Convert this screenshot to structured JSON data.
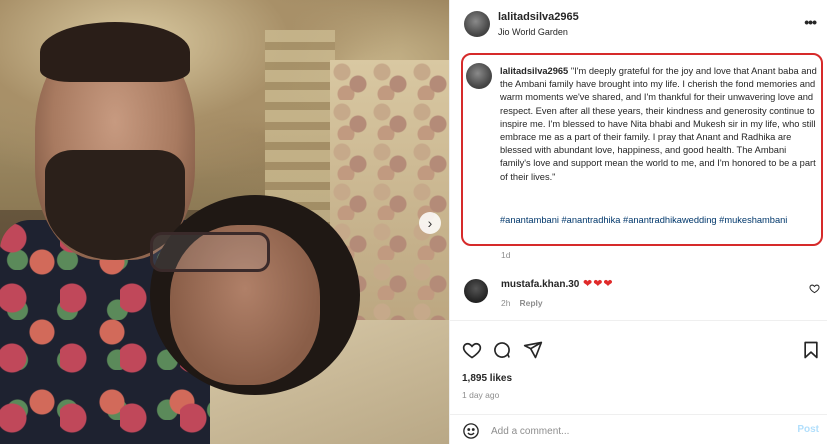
{
  "post": {
    "username": "lalitadsilva2965",
    "location": "Jio World Garden",
    "more_icon": "more-horizontal-icon"
  },
  "caption": {
    "username": "lalitadsilva2965",
    "text": "\"I'm deeply grateful for the joy and love that Anant baba and the Ambani family have brought into my life. I cherish the fond memories and warm moments we've shared, and I'm thankful for their unwavering love and respect. Even after all these years, their kindness and generosity continue to inspire me. I'm blessed to have Nita bhabi and Mukesh sir in my life, who still embrace me as a part of their family. I pray that Anant and Radhika are blessed with abundant love, happiness, and good health. The Ambani family's love and support mean the world to me, and I'm honored to be a part of their lives.\"",
    "hashtags": "#anantambani #anantradhika #anantradhikawedding #mukeshambani",
    "time": "1d",
    "highlight_color": "#d62a2a"
  },
  "comments": [
    {
      "username": "mustafa.khan.30",
      "text": "❤❤❤",
      "time": "2h",
      "reply_label": "Reply"
    }
  ],
  "actions": {
    "likes": "1,895 likes",
    "posted": "1 day ago",
    "icons": [
      "heart-icon",
      "comment-icon",
      "share-icon",
      "bookmark-icon"
    ]
  },
  "add_comment": {
    "placeholder": "Add a comment...",
    "post_label": "Post"
  },
  "photo": {
    "next_icon": "›"
  }
}
